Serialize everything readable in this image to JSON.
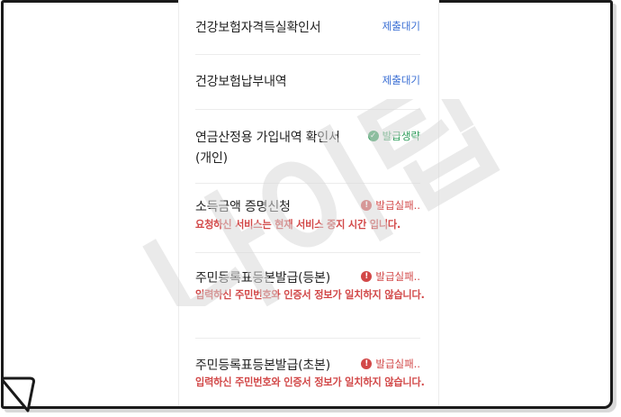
{
  "documents": [
    {
      "title": "건강보험자격득실확인서",
      "status": "제출대기"
    },
    {
      "title": "건강보험납부내역",
      "status": "제출대기"
    },
    {
      "title": "연금산정용 가입내역 확인서(개인)",
      "status": "발급생략"
    },
    {
      "title": "소득금액 증명신청",
      "status": "발급실패..",
      "error": "요청하신 서비스는 현재 서비스 중지 시간 입니다."
    },
    {
      "title": "주민등록표등본발급(등본)",
      "status": "발급실패..",
      "error": "입력하신 주민번호와 인증서 정보가 일치하지 않습니다."
    },
    {
      "title": "주민등록표등본발급(초본)",
      "status": "발급실패..",
      "error": "입력하신 주민번호와 인증서 정보가 일치하지 않습니다."
    }
  ],
  "watermark": {
    "text": "나이팁"
  },
  "colors": {
    "pending": "#3b6fd4",
    "omitted": "#2f9c5a",
    "failed": "#d24848",
    "watermark": "#d9d9d9"
  },
  "icons": {
    "omitted": "check-circle-icon",
    "failed": "alert-circle-icon"
  }
}
